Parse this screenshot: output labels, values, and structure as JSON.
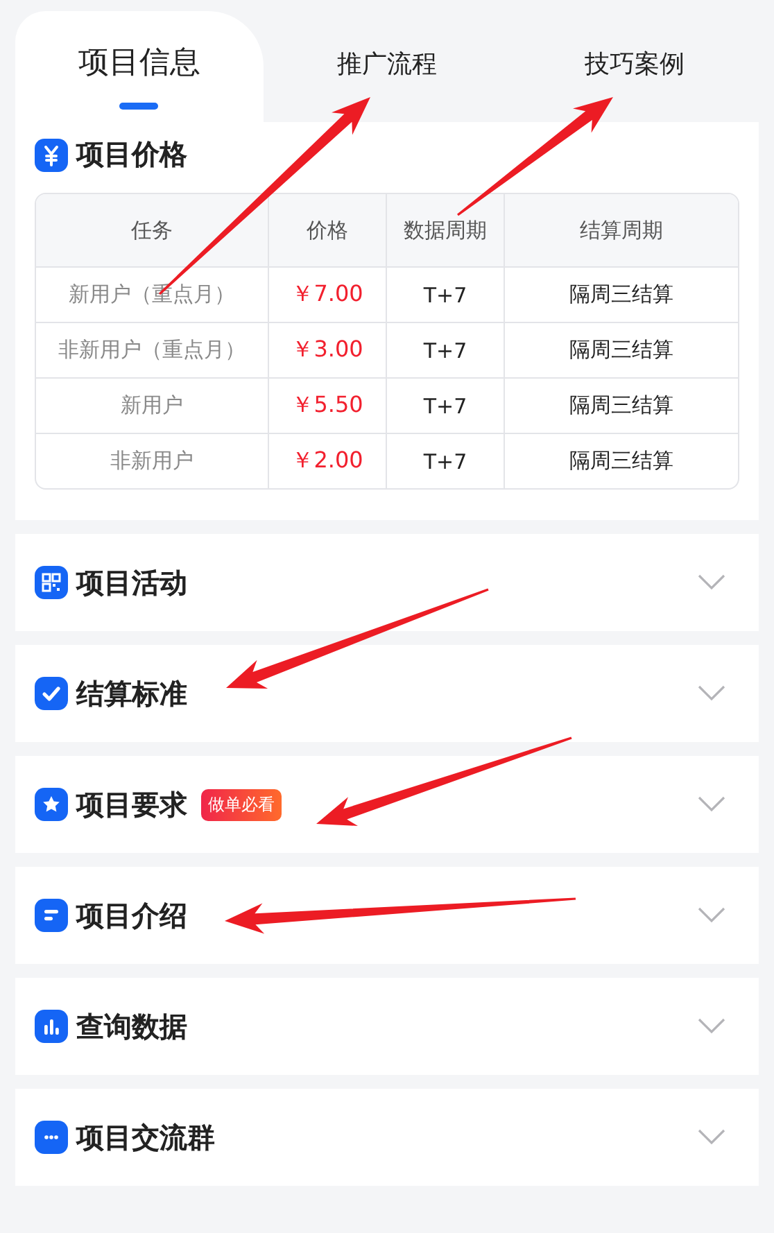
{
  "tabs": [
    {
      "label": "项目信息",
      "selected": true
    },
    {
      "label": "推广流程",
      "selected": false
    },
    {
      "label": "技巧案例",
      "selected": false
    }
  ],
  "price_section": {
    "title": "项目价格",
    "table": {
      "columns": [
        "任务",
        "价格",
        "数据周期",
        "结算周期"
      ],
      "rows": [
        [
          "新用户（重点月）",
          "￥7.00",
          "T+7",
          "隔周三结算"
        ],
        [
          "非新用户（重点月）",
          "￥3.00",
          "T+7",
          "隔周三结算"
        ],
        [
          "新用户",
          "￥5.50",
          "T+7",
          "隔周三结算"
        ],
        [
          "非新用户",
          "￥2.00",
          "T+7",
          "隔周三结算"
        ]
      ]
    }
  },
  "sections": [
    {
      "title": "项目活动",
      "kind": "qr",
      "expanded": false
    },
    {
      "title": "结算标准",
      "kind": "check",
      "expanded": false
    },
    {
      "title": "项目要求",
      "kind": "star",
      "expanded": false,
      "badge": "做单必看"
    },
    {
      "title": "项目介绍",
      "kind": "doc",
      "expanded": false
    },
    {
      "title": "查询数据",
      "kind": "chart",
      "expanded": false
    },
    {
      "title": "项目交流群",
      "kind": "chat",
      "expanded": false
    }
  ]
}
